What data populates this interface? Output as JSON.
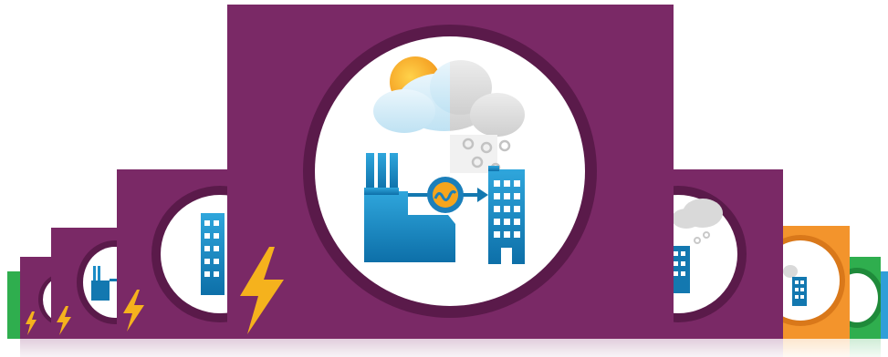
{
  "colors": {
    "purple": "#7a2966",
    "purple_ring": "#5a1a4a",
    "green": "#2fae4e",
    "orange": "#f3942c",
    "blue_edge": "#2f9fd8",
    "bolt": "#f5b21d",
    "factory_blue_top": "#2fa6dc",
    "factory_blue_bottom": "#0d6fa8",
    "cloud_light": "#d8eef8",
    "cloud_grey": "#d9d9d9",
    "sun": "#f7a92a"
  },
  "icons": {
    "center": "energy-plant-to-building-icon",
    "bolt": "lightning-bolt-icon"
  }
}
